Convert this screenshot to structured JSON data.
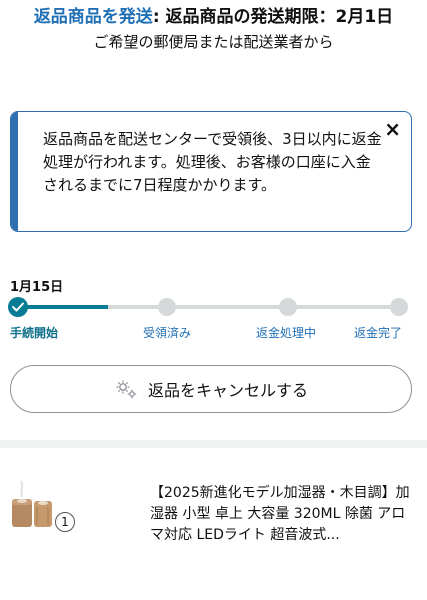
{
  "header": {
    "title_accent": "返品商品を発送",
    "title_rest": ": 返品商品の発送期限：2月1日",
    "subtitle": "ご希望の郵便局または配送業者から"
  },
  "notice": {
    "text": "返品商品を配送センターで受領後、3日以内に返金処理が行われます。処理後、お客様の口座に入金されるまでに7日程度かかります。",
    "close_icon": "×"
  },
  "progress": {
    "date": "1月15日",
    "current_step": 1,
    "steps": [
      {
        "label": "手続開始",
        "done": true
      },
      {
        "label": "受領済み",
        "done": false
      },
      {
        "label": "返金処理中",
        "done": false
      },
      {
        "label": "返金完了",
        "done": false
      }
    ],
    "accent_color": "#067d94"
  },
  "cancel_button": {
    "label": "返品をキャンセルする",
    "icon": "gear-icon"
  },
  "product": {
    "title": "【2025新進化モデル加湿器・木目調】加湿器 小型 卓上 大容量 320ML 除菌 アロマ対応 LEDライト 超音波式...",
    "quantity": "1"
  }
}
